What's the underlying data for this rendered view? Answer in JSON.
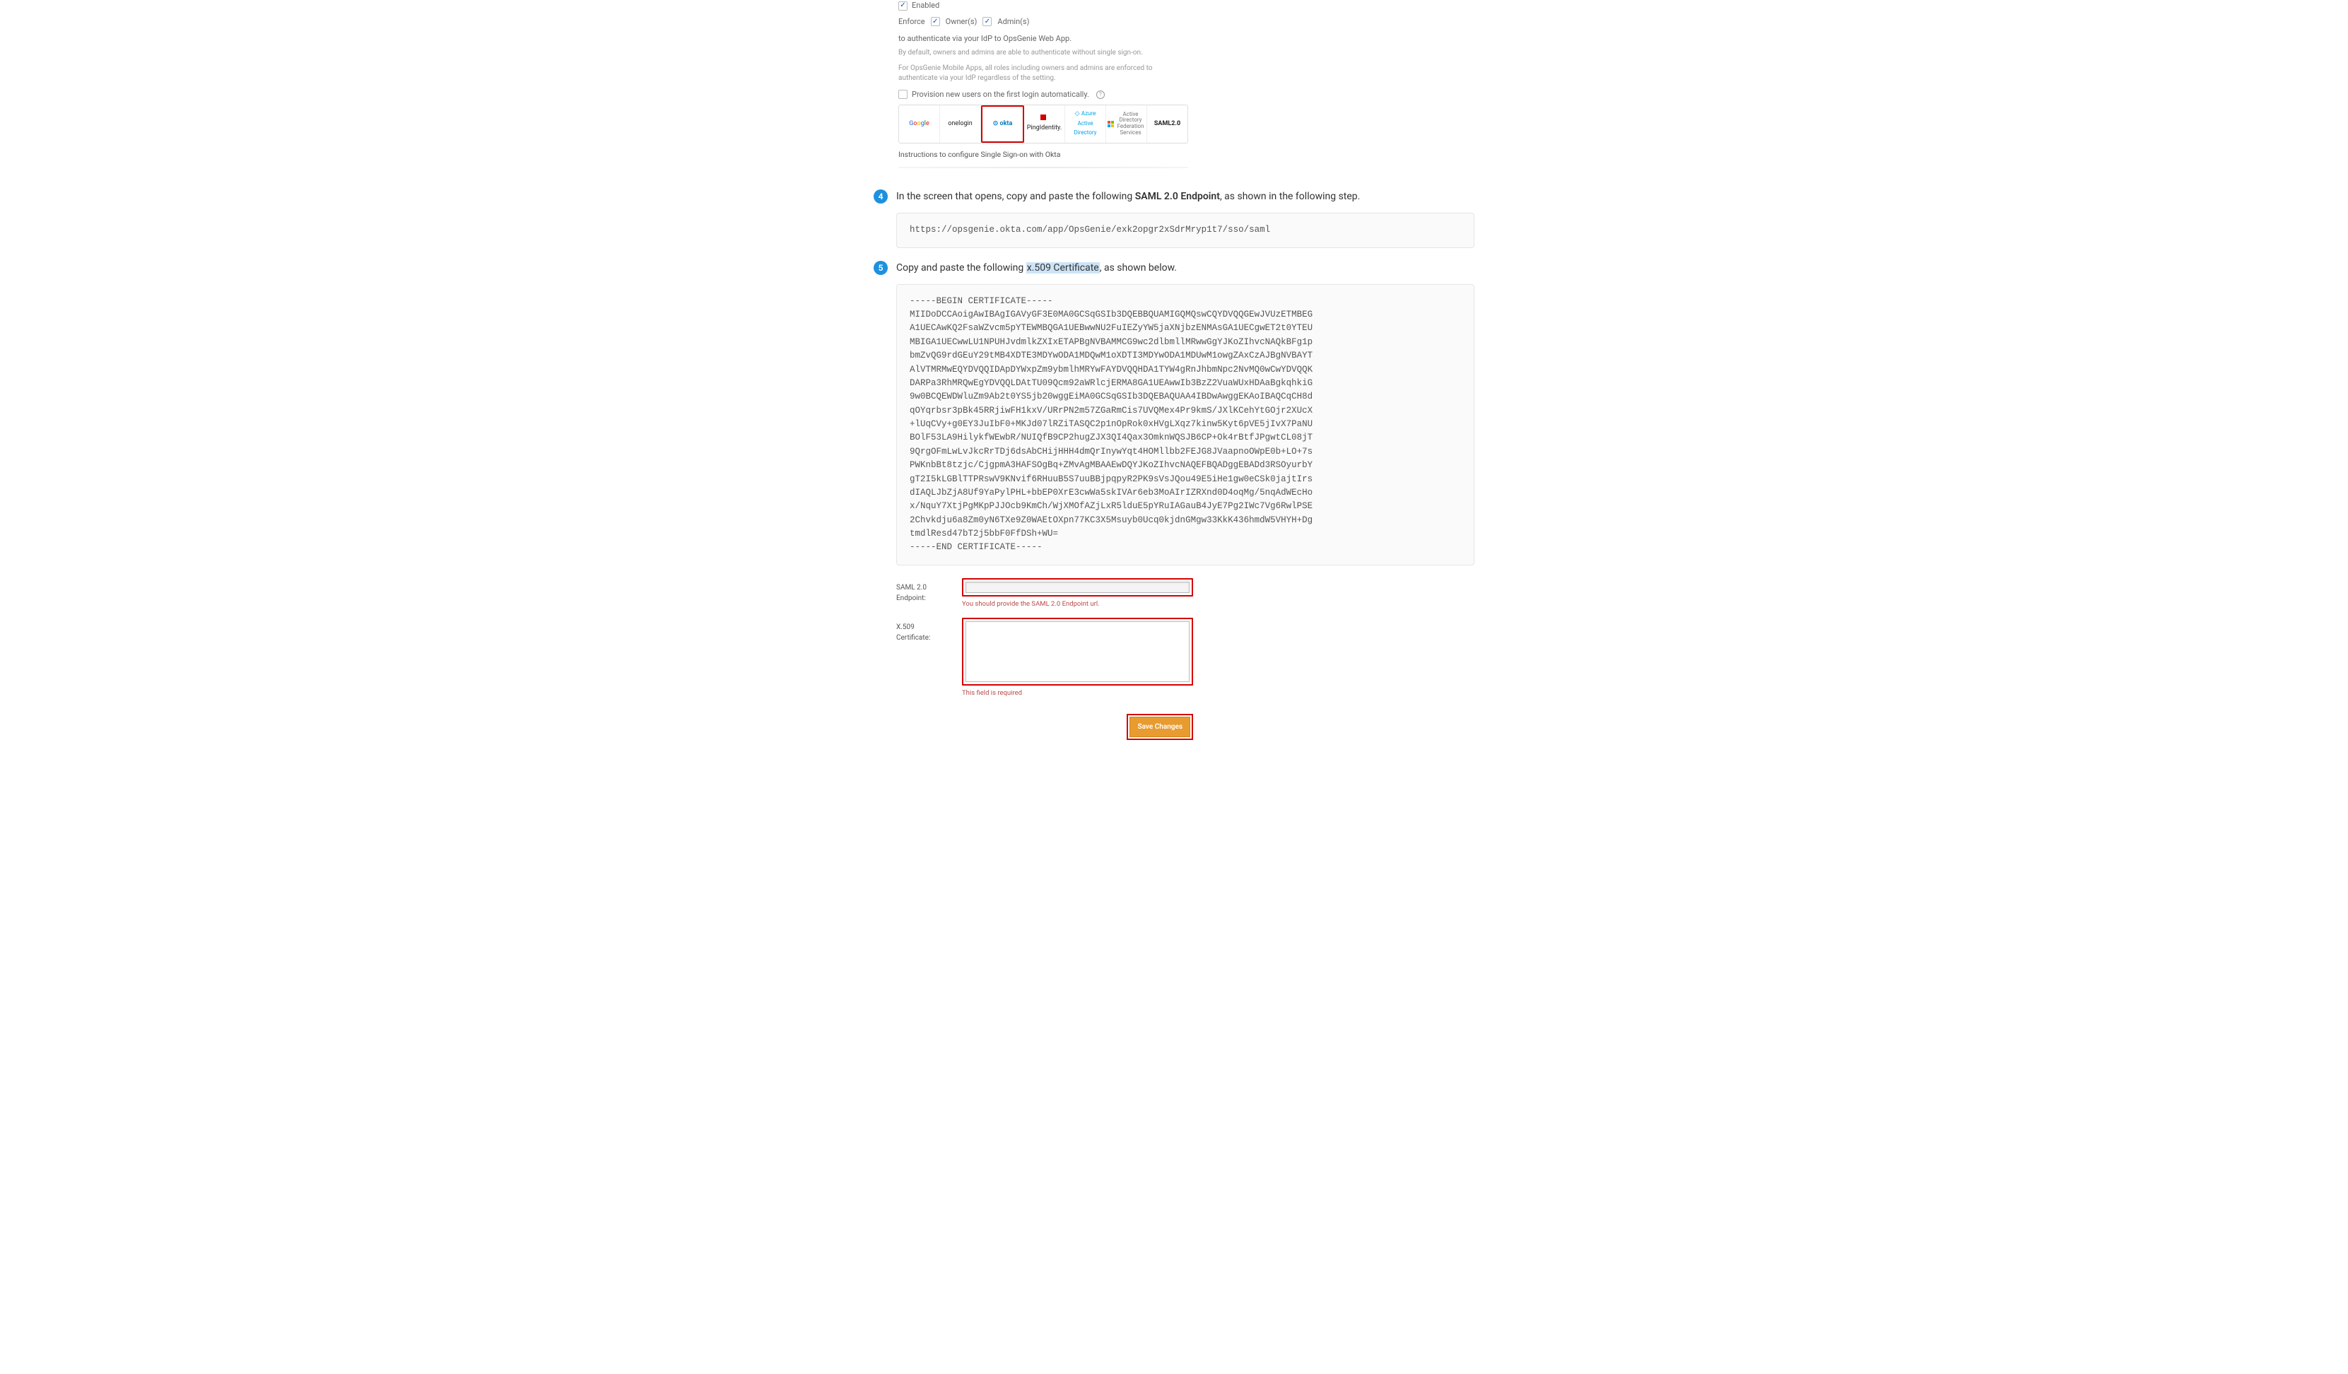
{
  "config": {
    "enabled_label": "Enabled",
    "enforce_label": "Enforce",
    "owner_label": "Owner(s)",
    "admin_label": "Admin(s)",
    "enforce_suffix": "to authenticate via your IdP to OpsGenie Web App.",
    "note1": "By default, owners and admins are able to authenticate without single sign-on.",
    "note2": "For OpsGenie Mobile Apps, all roles including owners and admins are enforced to authenticate via your IdP regardless of the setting.",
    "provision_label": "Provision new users on the first login automatically.",
    "idp": {
      "google": "Google",
      "onelogin": "onelogin",
      "okta": "okta",
      "ping": "PingIdentity.",
      "azure": "Azure Active Directory",
      "adfs": "Active Directory Federation Services",
      "saml": "SAML2.0"
    },
    "instructions": "Instructions to configure Single Sign-on with Okta"
  },
  "step4": {
    "num": "4",
    "pre": "In the screen that opens, copy and paste the following ",
    "bold": "SAML 2.0 Endpoint",
    "post": ", as shown in the following step.",
    "code": "https://opsgenie.okta.com/app/OpsGenie/exk2opgr2xSdrMryp1t7/sso/saml"
  },
  "step5": {
    "num": "5",
    "pre": "Copy and paste the following ",
    "hl": "x.509 Certificate",
    "post": ", as shown below.",
    "code": "-----BEGIN CERTIFICATE-----\nMIIDoDCCAoigAwIBAgIGAVyGF3E0MA0GCSqGSIb3DQEBBQUAMIGQMQswCQYDVQQGEwJVUzETMBEG\nA1UECAwKQ2FsaWZvcm5pYTEWMBQGA1UEBwwNU2FuIEZyYW5jaXNjbzENMAsGA1UECgwET2t0YTEU\nMBIGA1UECwwLU1NPUHJvdmlkZXIxETAPBgNVBAMMCG9wc2dlbmllMRwwGgYJKoZIhvcNAQkBFg1p\nbmZvQG9rdGEuY29tMB4XDTE3MDYwODA1MDQwM1oXDTI3MDYwODA1MDUwM1owgZAxCzAJBgNVBAYT\nAlVTMRMwEQYDVQQIDApDYWxpZm9ybmlhMRYwFAYDVQQHDA1TYW4gRnJhbmNpc2NvMQ0wCwYDVQQK\nDARPa3RhMRQwEgYDVQQLDAtTU09Qcm92aWRlcjERMA8GA1UEAwwIb3BzZ2VuaWUxHDAaBgkqhkiG\n9w0BCQEWDWluZm9Ab2t0YS5jb20wggEiMA0GCSqGSIb3DQEBAQUAA4IBDwAwggEKAoIBAQCqCH8d\nqOYqrbsr3pBk45RRjiwFH1kxV/URrPN2m57ZGaRmCis7UVQMex4Pr9kmS/JXlKCehYtGOjr2XUcX\n+lUqCVy+g0EY3JuIbF0+MKJd07lRZiTASQC2p1nOpRok0xHVgLXqz7kinw5Kyt6pVE5jIvX7PaNU\nBOlF53LA9HilykfWEwbR/NUIQfB9CP2hugZJX3QI4Qax3OmknWQSJB6CP+Ok4rBtfJPgwtCL08jT\n9QrgOFmLwLvJkcRrTDj6dsAbCHijHHH4dmQrInywYqt4HOMllbb2FEJG8JVaapnoOWpE0b+LO+7s\nPWKnbBt8tzjc/CjgpmA3HAFSOgBq+ZMvAgMBAAEwDQYJKoZIhvcNAQEFBQADggEBADd3RSOyurbY\ngT2I5kLGBlTTPRswV9KNvif6RHuuB5S7uuBBjpqpyR2PK9sVsJQou49E5iHe1gw0eCSk0jajtIrs\ndIAQLJbZjA8Uf9YaPylPHL+bbEP0XrE3cwWa5skIVAr6eb3MoAIrIZRXnd0D4oqMg/5nqAdWEcHo\nx/NquY7XtjPgMKpPJJOcb9KmCh/WjXMOfAZjLxR5lduE5pYRuIAGauB4JyE7Pg2IWc7Vg6RwlPSE\n2Chvkdju6a8Zm0yN6TXe9Z0WAEtOXpn77KC3X5Msuyb0Ucq0kjdnGMgw33KkK436hmdW5VHYH+Dg\ntmdlResd47bT2j5bbF0FfDSh+WU=\n-----END CERTIFICATE-----"
  },
  "samlform": {
    "endpoint_label": "SAML 2.0 Endpoint:",
    "endpoint_msg": "You should provide the SAML 2.0 Endpoint url.",
    "cert_label": "X.509 Certificate:",
    "cert_msg": "This field is required",
    "save_label": "Save Changes"
  }
}
